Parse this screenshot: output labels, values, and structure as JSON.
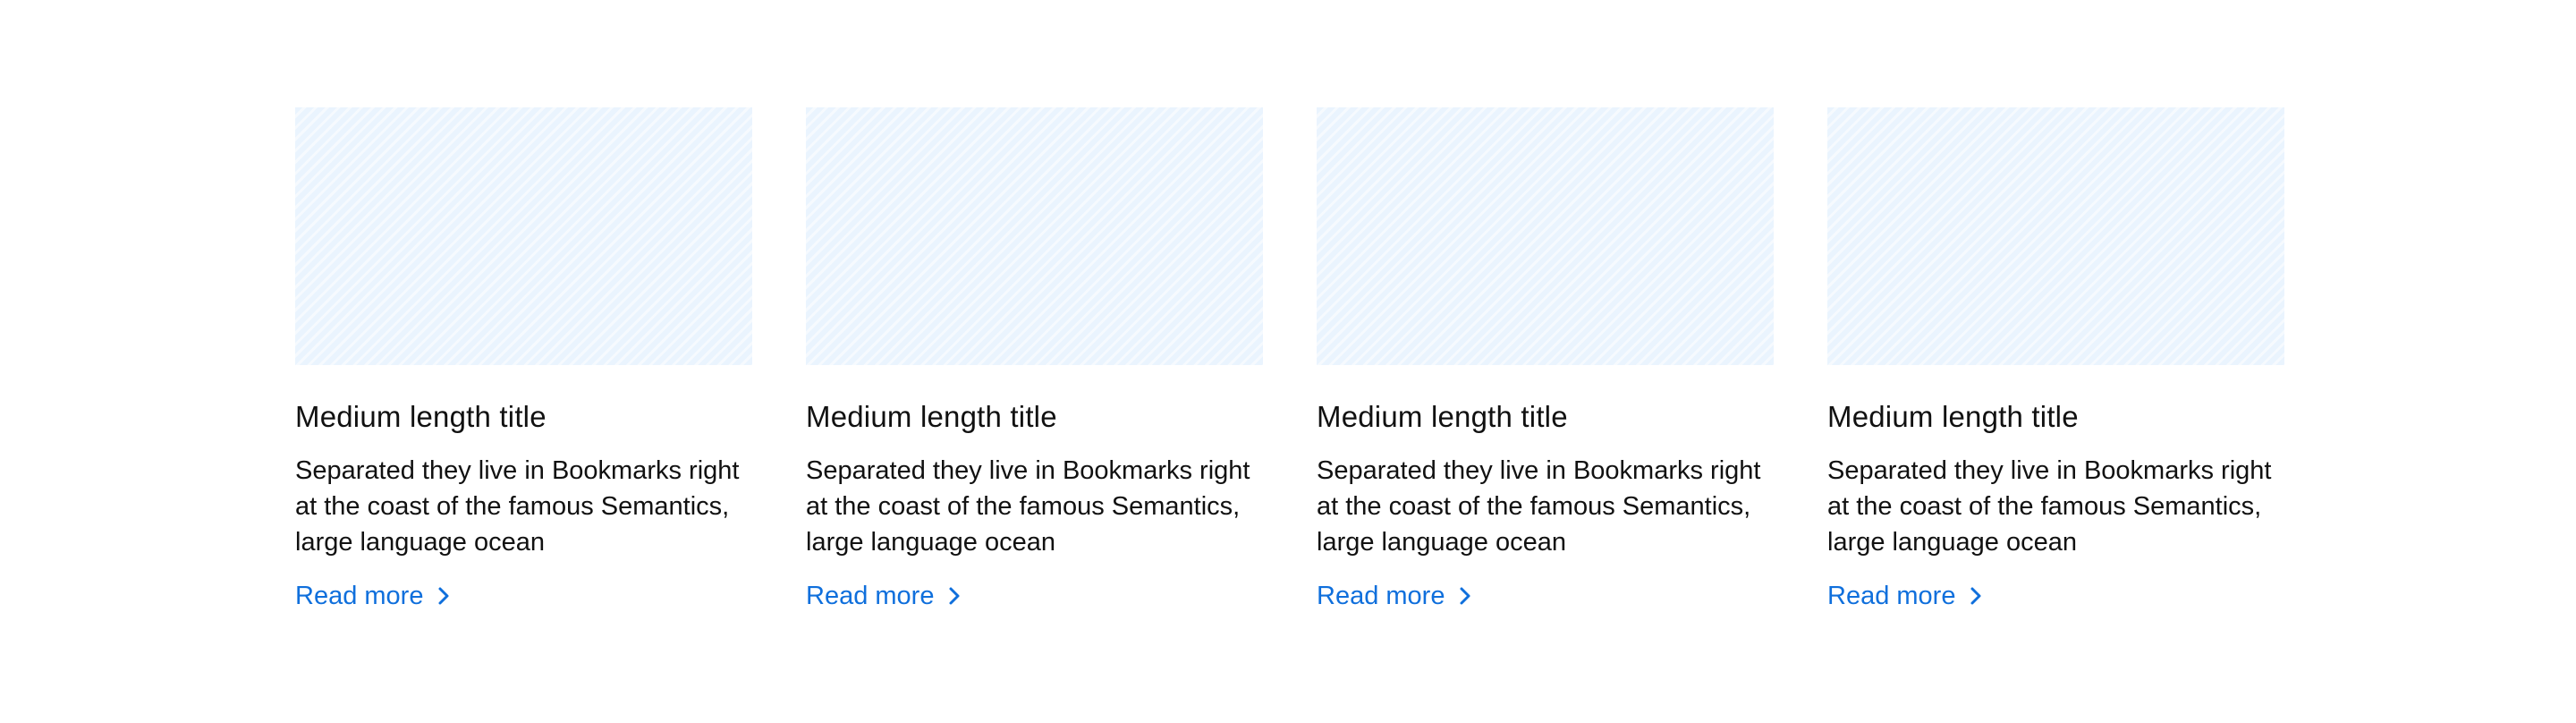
{
  "cards": [
    {
      "title": "Medium length title",
      "description_lines": [
        "Separated they live in Bookmarks right",
        "at the coast of the famous Semantics,",
        "large language ocean"
      ],
      "link_label": "Read more",
      "link_icon": "chevron-right-icon"
    },
    {
      "title": "Medium length title",
      "description_lines": [
        "Separated they live in Bookmarks right",
        "at the coast of the famous Semantics,",
        "large language ocean"
      ],
      "link_label": "Read more",
      "link_icon": "chevron-right-icon"
    },
    {
      "title": "Medium length title",
      "description_lines": [
        "Separated they live in Bookmarks right",
        "at the coast of the famous Semantics,",
        "large language ocean"
      ],
      "link_label": "Read more",
      "link_icon": "chevron-right-icon"
    },
    {
      "title": "Medium length title",
      "description_lines": [
        "Separated they live in Bookmarks right",
        "at the coast of the famous Semantics,",
        "large language ocean"
      ],
      "link_label": "Read more",
      "link_icon": "chevron-right-icon"
    }
  ],
  "colors": {
    "image_placeholder": "#eaf4fe",
    "link": "#0f6fdc",
    "text": "#111111"
  }
}
